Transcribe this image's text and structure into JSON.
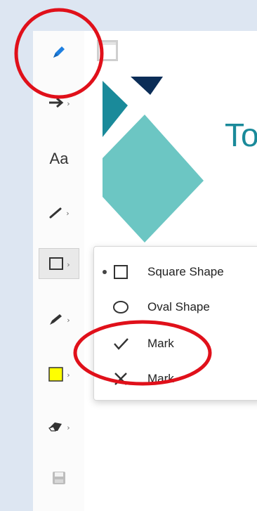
{
  "document": {
    "title_fragment": "To"
  },
  "toolbar": {
    "items": [
      {
        "name": "highlighter",
        "icon": "highlighter-icon",
        "active": true
      },
      {
        "name": "arrow",
        "icon": "arrow-right-icon"
      },
      {
        "name": "text",
        "label": "Aa"
      },
      {
        "name": "line",
        "icon": "line-icon"
      },
      {
        "name": "shape",
        "icon": "square-icon",
        "selected": true
      },
      {
        "name": "pen",
        "icon": "pen-icon"
      },
      {
        "name": "color",
        "icon": "color-swatch-icon",
        "color": "#ffff00"
      },
      {
        "name": "eraser",
        "icon": "eraser-icon"
      },
      {
        "name": "save",
        "icon": "save-icon"
      }
    ],
    "chevron": "›"
  },
  "shape_menu": {
    "items": [
      {
        "label": "Square Shape",
        "icon": "square-icon",
        "selected": true
      },
      {
        "label": "Oval Shape",
        "icon": "oval-icon"
      },
      {
        "label": "Mark",
        "icon": "checkmark-icon"
      },
      {
        "label": "Mark",
        "icon": "x-mark-icon"
      }
    ]
  },
  "colors": {
    "annotation": "#e0101a",
    "accent_blue": "#1e7fe0",
    "logo_teal": "#1a8a9a",
    "logo_light_teal": "#6cc6c3",
    "logo_navy": "#0b2d57",
    "swatch_yellow": "#ffff00"
  }
}
